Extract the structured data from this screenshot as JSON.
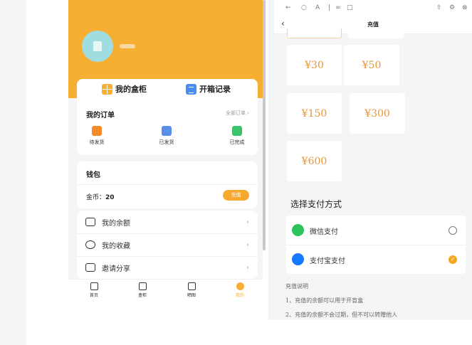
{
  "left": {
    "tabs": [
      {
        "label": "我的盒柜"
      },
      {
        "label": "开箱记录"
      }
    ],
    "orders": {
      "title": "我的订单",
      "all_label": "全部订单 ›",
      "items": [
        {
          "label": "待发货"
        },
        {
          "label": "已发货"
        },
        {
          "label": "已完成"
        }
      ]
    },
    "wallet": {
      "title": "钱包",
      "coins_label": "金币：",
      "coins_value": "20",
      "recharge_label": "充值"
    },
    "menu": [
      {
        "label": "我的余额",
        "chevron": "›"
      },
      {
        "label": "我的收藏",
        "chevron": "›"
      },
      {
        "label": "邀请分享",
        "chevron": "›"
      }
    ],
    "tabbar": [
      {
        "label": "首页"
      },
      {
        "label": "盒柜"
      },
      {
        "label": "晒图"
      },
      {
        "label": "我的"
      }
    ],
    "colors": {
      "brand": "#f6ae33"
    }
  },
  "right": {
    "nav": {
      "back": "‹",
      "title": "充值"
    },
    "amounts": [
      "¥30",
      "¥50",
      "¥150",
      "¥300",
      "¥600"
    ],
    "pay_title": "选择支付方式",
    "pay_methods": [
      {
        "label": "微信支付",
        "selected": false,
        "icon": "wechat-icon"
      },
      {
        "label": "支付宝支付",
        "selected": true,
        "icon": "alipay-icon"
      }
    ],
    "notes": {
      "title": "充值说明",
      "lines": [
        "1、充值的余额可以用于开盲盒",
        "2、充值的余额不会过期，但不可以转赠他人"
      ]
    },
    "colors": {
      "amount": "#e8963a",
      "selected": "#f5a623"
    }
  }
}
